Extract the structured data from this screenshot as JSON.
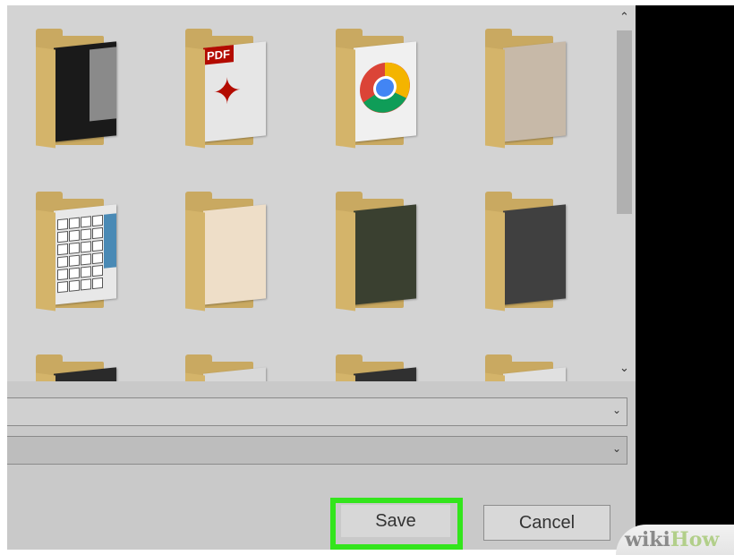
{
  "dialog": {
    "scroll_up_glyph": "⌃",
    "scroll_down_glyph": "⌄",
    "folders": [
      {
        "icon": "black-window-folder-icon",
        "paper_color": "#1a1a1a"
      },
      {
        "icon": "pdf-folder-icon",
        "paper_color": "#e6e6e6",
        "pdf_text": "PDF"
      },
      {
        "icon": "chrome-folder-icon",
        "paper_color": "#f0f0f0"
      },
      {
        "icon": "cake-photo-folder-icon",
        "paper_color": "#c7b9a8"
      },
      {
        "icon": "keyboard-photo-folder-icon",
        "paper_color": "#e8e8e8"
      },
      {
        "icon": "baby-photo-folder-icon",
        "paper_color": "#eedec8"
      },
      {
        "icon": "people-photo-folder-icon",
        "paper_color": "#3a4030"
      },
      {
        "icon": "dark-photo-folder-icon",
        "paper_color": "#404040"
      },
      {
        "icon": "folder-icon",
        "paper_color": "#2a2a2a"
      },
      {
        "icon": "folder-icon",
        "paper_color": "#d8d8d8"
      },
      {
        "icon": "folder-icon",
        "paper_color": "#303030"
      },
      {
        "icon": "folder-icon",
        "paper_color": "#e0e0e0"
      }
    ],
    "file_name_field": {
      "value": "",
      "chevron": "⌄"
    },
    "save_as_type_field": {
      "value": "",
      "chevron": "⌄"
    },
    "save_button_label": "Save",
    "cancel_button_label": "Cancel",
    "highlight_color": "#33e51c"
  },
  "watermark": {
    "part1": "wiki",
    "part2": "How"
  }
}
